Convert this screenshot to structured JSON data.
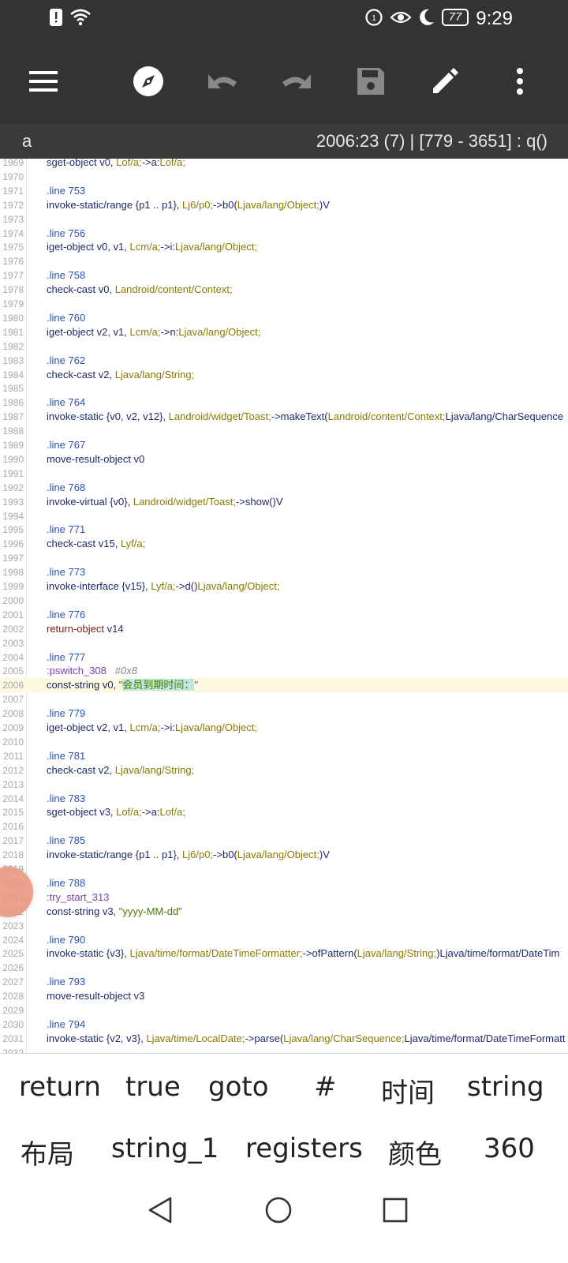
{
  "status": {
    "time": "9:29",
    "battery": "77",
    "icons": [
      "alert-icon",
      "wifi-icon",
      "data-saver-icon",
      "eye-icon",
      "moon-icon"
    ]
  },
  "toolbar": {
    "buttons": [
      "menu-icon",
      "compass-icon",
      "undo-icon",
      "redo-icon",
      "save-icon",
      "edit-icon",
      "more-icon"
    ]
  },
  "info": {
    "left": "a",
    "right": "2006:23 (7)  |  [779 - 3651] : q()"
  },
  "code_lines": [
    {
      "n": "1969",
      "t": "sget-object v0, Lof/a;->a:Lof/a;"
    },
    {
      "n": "1970",
      "t": ""
    },
    {
      "n": "1971",
      "t": ".line 753"
    },
    {
      "n": "1972",
      "t": "invoke-static/range {p1 .. p1}, Lj6/p0;->b0(Ljava/lang/Object;)V"
    },
    {
      "n": "1973",
      "t": ""
    },
    {
      "n": "1974",
      "t": ".line 756"
    },
    {
      "n": "1975",
      "t": "iget-object v0, v1, Lcm/a;->i:Ljava/lang/Object;"
    },
    {
      "n": "1976",
      "t": ""
    },
    {
      "n": "1977",
      "t": ".line 758"
    },
    {
      "n": "1978",
      "t": "check-cast v0, Landroid/content/Context;"
    },
    {
      "n": "1979",
      "t": ""
    },
    {
      "n": "1980",
      "t": ".line 760"
    },
    {
      "n": "1981",
      "t": "iget-object v2, v1, Lcm/a;->n:Ljava/lang/Object;"
    },
    {
      "n": "1982",
      "t": ""
    },
    {
      "n": "1983",
      "t": ".line 762"
    },
    {
      "n": "1984",
      "t": "check-cast v2, Ljava/lang/String;"
    },
    {
      "n": "1985",
      "t": ""
    },
    {
      "n": "1986",
      "t": ".line 764"
    },
    {
      "n": "1987",
      "t": "invoke-static {v0, v2, v12}, Landroid/widget/Toast;->makeText(Landroid/content/Context;Ljava/lang/CharSequence"
    },
    {
      "n": "1988",
      "t": ""
    },
    {
      "n": "1989",
      "t": ".line 767"
    },
    {
      "n": "1990",
      "t": "move-result-object v0"
    },
    {
      "n": "1991",
      "t": ""
    },
    {
      "n": "1992",
      "t": ".line 768"
    },
    {
      "n": "1993",
      "t": "invoke-virtual {v0}, Landroid/widget/Toast;->show()V"
    },
    {
      "n": "1994",
      "t": ""
    },
    {
      "n": "1995",
      "t": ".line 771"
    },
    {
      "n": "1996",
      "t": "check-cast v15, Lyf/a;"
    },
    {
      "n": "1997",
      "t": ""
    },
    {
      "n": "1998",
      "t": ".line 773"
    },
    {
      "n": "1999",
      "t": "invoke-interface {v15}, Lyf/a;->d()Ljava/lang/Object;"
    },
    {
      "n": "2000",
      "t": ""
    },
    {
      "n": "2001",
      "t": ".line 776"
    },
    {
      "n": "2002",
      "t": "return-object v14"
    },
    {
      "n": "2003",
      "t": ""
    },
    {
      "n": "2004",
      "t": ".line 777"
    },
    {
      "n": "2005",
      "t": ":pswitch_308  #0x8"
    },
    {
      "n": "2006",
      "t": "const-string v0, \"会员到期时间：\""
    },
    {
      "n": "2007",
      "t": ""
    },
    {
      "n": "2008",
      "t": ".line 779"
    },
    {
      "n": "2009",
      "t": "iget-object v2, v1, Lcm/a;->i:Ljava/lang/Object;"
    },
    {
      "n": "2010",
      "t": ""
    },
    {
      "n": "2011",
      "t": ".line 781"
    },
    {
      "n": "2012",
      "t": "check-cast v2, Ljava/lang/String;"
    },
    {
      "n": "2013",
      "t": ""
    },
    {
      "n": "2014",
      "t": ".line 783"
    },
    {
      "n": "2015",
      "t": "sget-object v3, Lof/a;->a:Lof/a;"
    },
    {
      "n": "2016",
      "t": ""
    },
    {
      "n": "2017",
      "t": ".line 785"
    },
    {
      "n": "2018",
      "t": "invoke-static/range {p1 .. p1}, Lj6/p0;->b0(Ljava/lang/Object;)V"
    },
    {
      "n": "2019",
      "t": ""
    },
    {
      "n": "2020",
      "t": ".line 788"
    },
    {
      "n": "2021",
      "t": ":try_start_313"
    },
    {
      "n": "2022",
      "t": "const-string v3, \"yyyy-MM-dd\""
    },
    {
      "n": "2023",
      "t": ""
    },
    {
      "n": "2024",
      "t": ".line 790"
    },
    {
      "n": "2025",
      "t": "invoke-static {v3}, Ljava/time/format/DateTimeFormatter;->ofPattern(Ljava/lang/String;)Ljava/time/format/DateTim"
    },
    {
      "n": "2026",
      "t": ""
    },
    {
      "n": "2027",
      "t": ".line 793"
    },
    {
      "n": "2028",
      "t": "move-result-object v3"
    },
    {
      "n": "2029",
      "t": ""
    },
    {
      "n": "2030",
      "t": ".line 794"
    },
    {
      "n": "2031",
      "t": "invoke-static {v2, v3}, Ljava/time/LocalDate;->parse(Ljava/lang/CharSequence;Ljava/time/format/DateTimeFormatt"
    },
    {
      "n": "2032",
      "t": ""
    }
  ],
  "keys_row1": [
    "return",
    "true",
    "goto",
    "#",
    "时间",
    "string"
  ],
  "keys_row2": [
    "布局",
    "string_1",
    "registers",
    "颜色",
    "360"
  ],
  "nav": [
    "back-icon",
    "home-icon",
    "recents-icon"
  ]
}
